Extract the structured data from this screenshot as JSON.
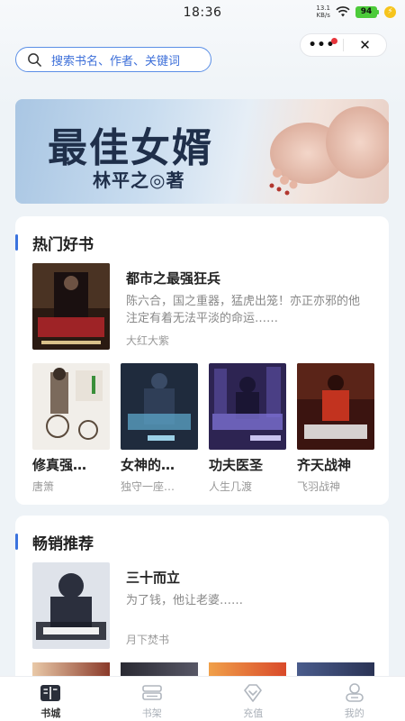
{
  "status_bar": {
    "time": "18:36",
    "net_speed_value": "13.1",
    "net_speed_unit": "KB/s",
    "battery": "94"
  },
  "search": {
    "placeholder": "搜索书名、作者、关键词"
  },
  "banner": {
    "title": "最佳女婿",
    "author_line": "林平之◎著"
  },
  "hot_section": {
    "title": "热门好书",
    "featured": {
      "title": "都市之最强狂兵",
      "description": "陈六合，国之重器，猛虎出笼！亦正亦邪的他注定有着无法平淡的命运……",
      "author": "大红大紫",
      "cover_colors": [
        "#2a1a12",
        "#b3262a"
      ]
    },
    "books": [
      {
        "title": "修真强少在校园",
        "title_shown": "修真强…",
        "author": "唐箫",
        "cover_colors": [
          "#f1eee9",
          "#7b6a5c"
        ]
      },
      {
        "title": "女神的…",
        "title_shown": "女神的…",
        "author": "独守一座空城",
        "author_shown": "独守一座…",
        "cover_colors": [
          "#1f2b3d",
          "#5da7c9"
        ]
      },
      {
        "title": "功夫医圣",
        "title_shown": "功夫医圣",
        "author": "人生几渡",
        "cover_colors": [
          "#2d2452",
          "#7b6fd1"
        ]
      },
      {
        "title": "齐天战神",
        "title_shown": "齐天战神",
        "author": "飞羽战神",
        "cover_colors": [
          "#3b1410",
          "#c2331f"
        ]
      }
    ]
  },
  "best_section": {
    "title": "畅销推荐",
    "featured": {
      "title": "三十而立",
      "description": "为了钱，他让老婆……",
      "author": "月下焚书",
      "cover_colors": [
        "#dfe3ea",
        "#2b2f3d"
      ]
    }
  },
  "bottom_nav": [
    {
      "label": "书城",
      "icon": "book-open-icon",
      "active": true
    },
    {
      "label": "书架",
      "icon": "bookshelf-icon",
      "active": false
    },
    {
      "label": "充值",
      "icon": "diamond-icon",
      "active": false
    },
    {
      "label": "我的",
      "icon": "user-icon",
      "active": false
    }
  ],
  "colors": {
    "accent": "#3b73de",
    "search_border": "#5b8fe6",
    "text_primary": "#222222",
    "text_secondary": "#888888"
  }
}
